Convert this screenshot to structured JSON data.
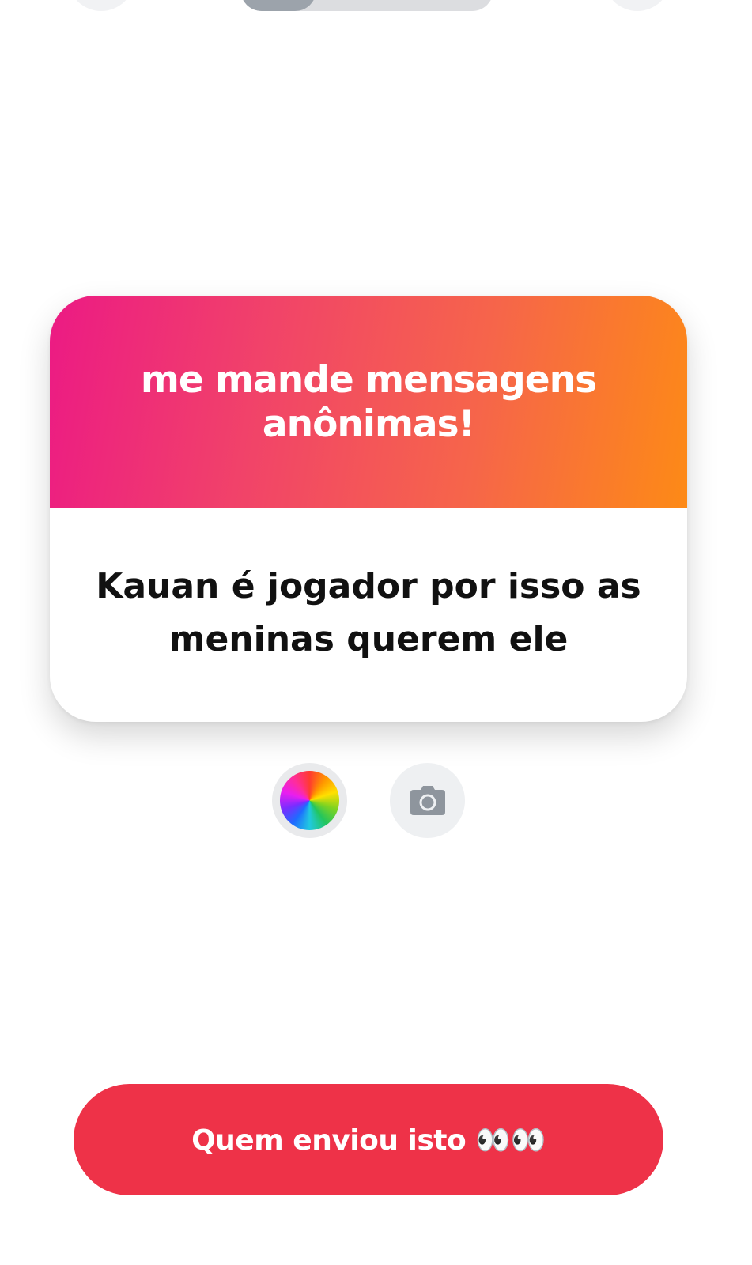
{
  "top_bar": {
    "left_control_icon": "circle-button",
    "right_control_icon": "circle-button",
    "progress": 0.3
  },
  "card": {
    "title": "me mande mensagens anônimas!",
    "message": "Kauan é jogador por isso as meninas querem ele",
    "gradient_colors": [
      "#ec1a84",
      "#f14369",
      "#f6654a",
      "#fd8a16"
    ]
  },
  "controls": {
    "color_icon": "color-wheel-icon",
    "camera_icon": "camera-icon"
  },
  "cta": {
    "label": "Quem enviou isto 👀👀",
    "color": "#ee3248"
  }
}
